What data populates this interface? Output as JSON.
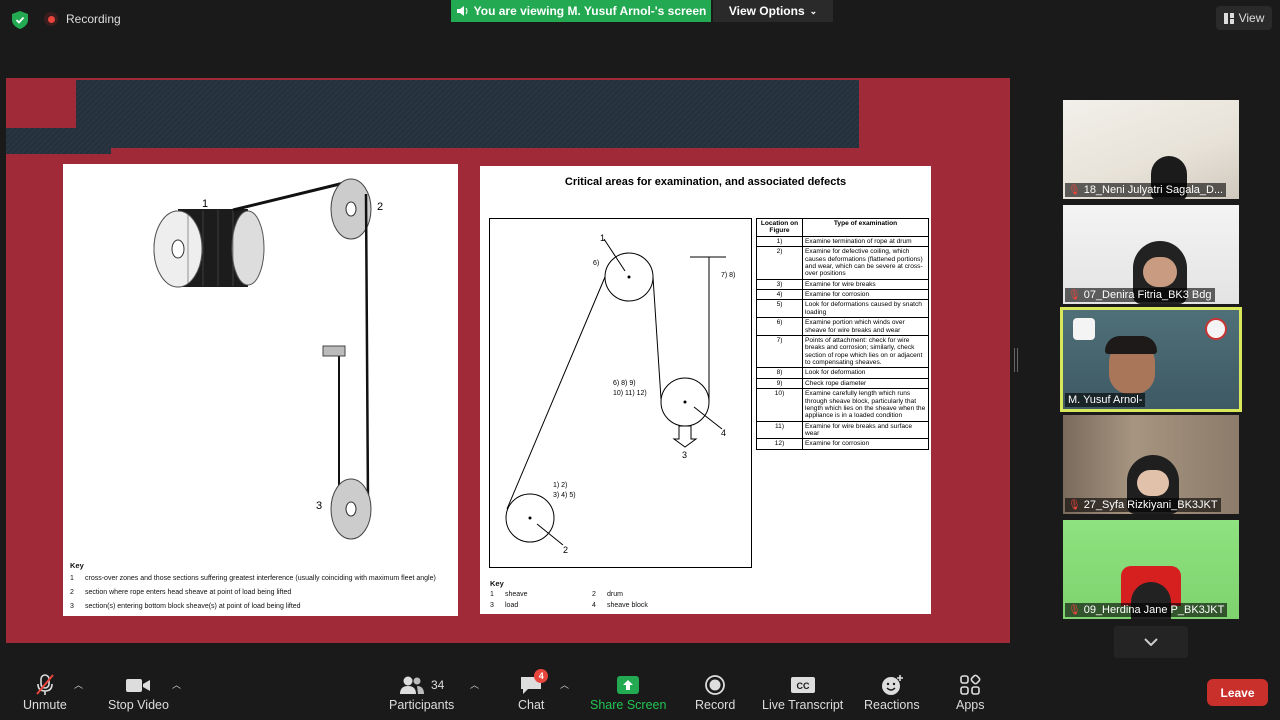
{
  "topbar": {
    "recording_label": "Recording",
    "viewing_banner": "You are viewing M. Yusuf Arnol-'s screen",
    "view_options_label": "View Options",
    "view_button_label": "View"
  },
  "shared_screen": {
    "left_figure": {
      "callouts": [
        "1",
        "2",
        "3"
      ],
      "key_title": "Key",
      "key_items": [
        {
          "num": "1",
          "text": "cross-over zones and those sections suffering greatest interference (usually coinciding with maximum fleet angle)"
        },
        {
          "num": "2",
          "text": "section where rope enters head sheave at point of load being lifted"
        },
        {
          "num": "3",
          "text": "section(s) entering bottom block sheave(s) at point of load being lifted"
        }
      ]
    },
    "right_figure": {
      "title": "Critical areas for examination, and associated defects",
      "diagram_labels": {
        "l1": "1",
        "l6": "6)",
        "l78": "7)   8)",
        "l6to12a": "6)    8)    9)",
        "l6to12b": "10)    11)    12)",
        "l4": "4",
        "l3": "3",
        "lbottom_a": "1)    2)",
        "lbottom_b": "3)    4)    5)",
        "l2": "2"
      },
      "table_headers": [
        "Location on Figure",
        "Type of examination"
      ],
      "table_rows": [
        {
          "loc": "1)",
          "text": "Examine termination of rope at drum"
        },
        {
          "loc": "2)",
          "text": "Examine for defective coiling, which causes deformations (flattened portions) and wear, which can be severe at cross-over positions"
        },
        {
          "loc": "3)",
          "text": "Examine for wire breaks"
        },
        {
          "loc": "4)",
          "text": "Examine for corrosion"
        },
        {
          "loc": "5)",
          "text": "Look for deformations caused by snatch loading"
        },
        {
          "loc": "6)",
          "text": "Examine portion which winds over sheave for wire breaks and wear"
        },
        {
          "loc": "7)",
          "text": "Points of attachment: check for wire breaks and corrosion; similarly, check section of rope which lies on or adjacent to compensating sheaves."
        },
        {
          "loc": "8)",
          "text": "Look for deformation"
        },
        {
          "loc": "9)",
          "text": "Check rope diameter"
        },
        {
          "loc": "10)",
          "text": "Examine carefully length which runs through sheave block, particularly that length which lies on the sheave when the appliance is in a loaded condition"
        },
        {
          "loc": "11)",
          "text": "Examine for wire breaks and surface wear"
        },
        {
          "loc": "12)",
          "text": "Examine for corrosion"
        }
      ],
      "key_title": "Key",
      "key_items": [
        {
          "num": "1",
          "text": "sheave"
        },
        {
          "num": "2",
          "text": "drum"
        },
        {
          "num": "3",
          "text": "load"
        },
        {
          "num": "4",
          "text": "sheave block"
        }
      ]
    }
  },
  "participants_panel": [
    {
      "name": "18_Neni Julyatri Sagala_D...",
      "muted": true
    },
    {
      "name": "07_Denira Fitria_BK3 Bdg",
      "muted": true
    },
    {
      "name": "M. Yusuf Arnol-",
      "muted": false,
      "active": true
    },
    {
      "name": "27_Syfa Rizkiyani_BK3JKT",
      "muted": true
    },
    {
      "name": "09_Herdina Jane P_BK3JKT",
      "muted": true
    }
  ],
  "toolbar": {
    "unmute": "Unmute",
    "stop_video": "Stop Video",
    "participants": "Participants",
    "participants_count": "34",
    "chat": "Chat",
    "chat_badge": "4",
    "share_screen": "Share Screen",
    "record": "Record",
    "live_transcript": "Live Transcript",
    "reactions": "Reactions",
    "apps": "Apps",
    "leave": "Leave"
  },
  "colors": {
    "share_green": "#23a952",
    "leave_red": "#c9302c",
    "slide_bg": "#a12a38",
    "active_speaker": "#d9e85b"
  }
}
